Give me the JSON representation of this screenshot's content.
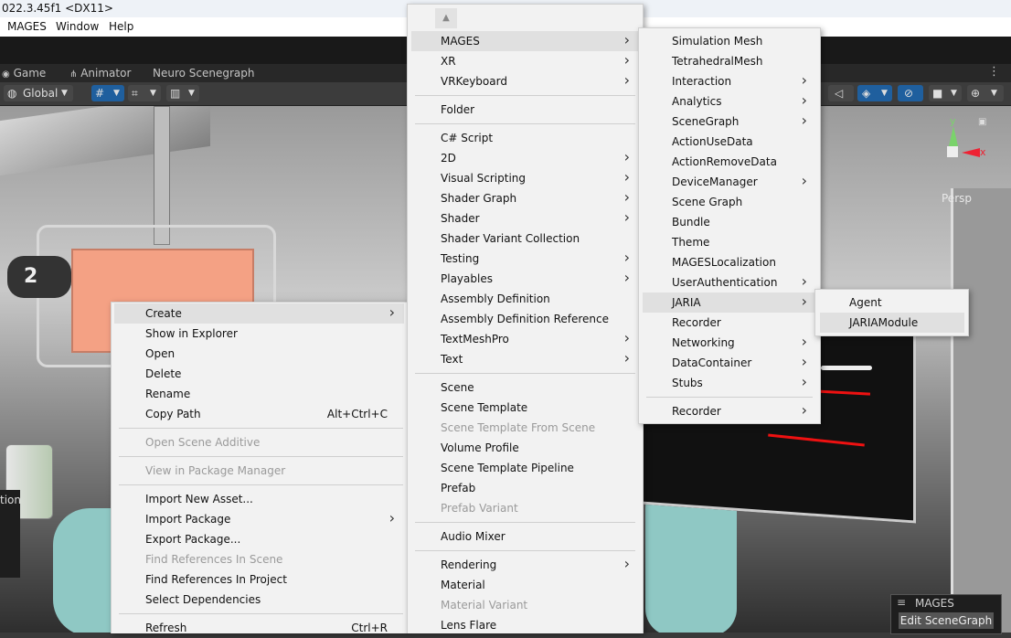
{
  "window": {
    "title": "022.3.45f1 <DX11>"
  },
  "menubar": [
    "MAGES",
    "Window",
    "Help"
  ],
  "tabs": [
    "Game",
    "Animator",
    "Neuro Scenegraph"
  ],
  "toolbar": {
    "global_label": "Global"
  },
  "scene": {
    "counter": "2",
    "axis_y": "y",
    "axis_x": "x",
    "persp": "Persp",
    "partial_text": "tion"
  },
  "badge": {
    "title": "MAGES",
    "button": "Edit SceneGraph"
  },
  "context_menu": {
    "items": [
      {
        "label": "Create",
        "arrow": true
      },
      {
        "label": "Show in Explorer"
      },
      {
        "label": "Open"
      },
      {
        "label": "Delete"
      },
      {
        "label": "Rename"
      },
      {
        "label": "Copy Path",
        "shortcut": "Alt+Ctrl+C"
      },
      {
        "label": "Open Scene Additive",
        "disabled": true
      },
      {
        "label": "View in Package Manager",
        "disabled": true
      },
      {
        "label": "Import New Asset..."
      },
      {
        "label": "Import Package",
        "arrow": true
      },
      {
        "label": "Export Package..."
      },
      {
        "label": "Find References In Scene",
        "disabled": true
      },
      {
        "label": "Find References In Project"
      },
      {
        "label": "Select Dependencies"
      },
      {
        "label": "Refresh",
        "shortcut": "Ctrl+R"
      }
    ]
  },
  "create_menu": {
    "items": [
      {
        "label": "MAGES",
        "arrow": true
      },
      {
        "label": "XR",
        "arrow": true
      },
      {
        "label": "VRKeyboard",
        "arrow": true
      },
      {
        "label": "Folder"
      },
      {
        "label": "C# Script"
      },
      {
        "label": "2D",
        "arrow": true
      },
      {
        "label": "Visual Scripting",
        "arrow": true
      },
      {
        "label": "Shader Graph",
        "arrow": true
      },
      {
        "label": "Shader",
        "arrow": true
      },
      {
        "label": "Shader Variant Collection"
      },
      {
        "label": "Testing",
        "arrow": true
      },
      {
        "label": "Playables",
        "arrow": true
      },
      {
        "label": "Assembly Definition"
      },
      {
        "label": "Assembly Definition Reference"
      },
      {
        "label": "TextMeshPro",
        "arrow": true
      },
      {
        "label": "Text",
        "arrow": true
      },
      {
        "label": "Scene"
      },
      {
        "label": "Scene Template"
      },
      {
        "label": "Scene Template From Scene",
        "disabled": true
      },
      {
        "label": "Volume Profile"
      },
      {
        "label": "Scene Template Pipeline"
      },
      {
        "label": "Prefab"
      },
      {
        "label": "Prefab Variant",
        "disabled": true
      },
      {
        "label": "Audio Mixer"
      },
      {
        "label": "Rendering",
        "arrow": true
      },
      {
        "label": "Material"
      },
      {
        "label": "Material Variant",
        "disabled": true
      },
      {
        "label": "Lens Flare"
      }
    ]
  },
  "mages_menu": {
    "items": [
      {
        "label": "Simulation Mesh"
      },
      {
        "label": "TetrahedralMesh"
      },
      {
        "label": "Interaction",
        "arrow": true
      },
      {
        "label": "Analytics",
        "arrow": true
      },
      {
        "label": "SceneGraph",
        "arrow": true
      },
      {
        "label": "ActionUseData"
      },
      {
        "label": "ActionRemoveData"
      },
      {
        "label": "DeviceManager",
        "arrow": true
      },
      {
        "label": "Scene Graph"
      },
      {
        "label": "Bundle"
      },
      {
        "label": "Theme"
      },
      {
        "label": "MAGESLocalization"
      },
      {
        "label": "UserAuthentication",
        "arrow": true
      },
      {
        "label": "JARIA",
        "arrow": true
      },
      {
        "label": "Recorder"
      },
      {
        "label": "Networking",
        "arrow": true
      },
      {
        "label": "DataContainer",
        "arrow": true
      },
      {
        "label": "Stubs",
        "arrow": true
      },
      {
        "label": "Recorder",
        "arrow": true
      }
    ]
  },
  "jaria_menu": {
    "items": [
      {
        "label": "Agent"
      },
      {
        "label": "JARIAModule"
      }
    ]
  }
}
